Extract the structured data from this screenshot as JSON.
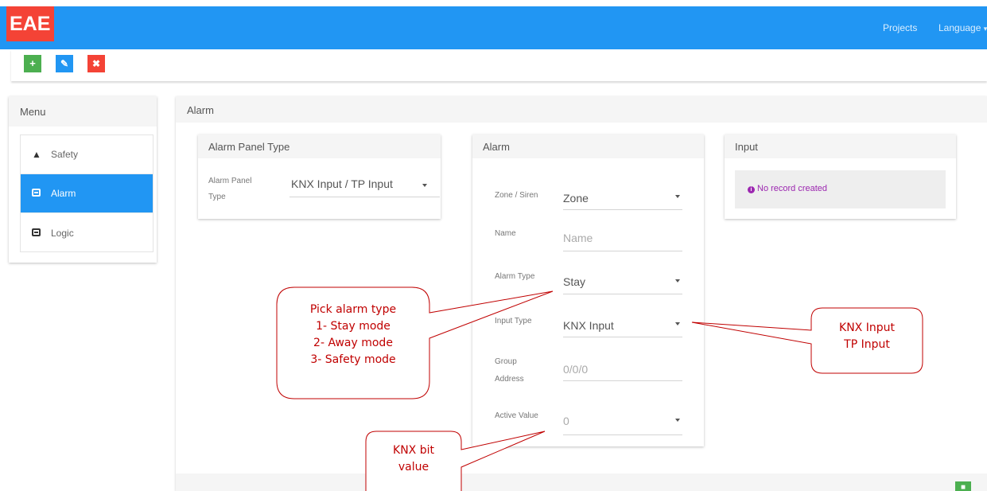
{
  "app": {
    "logo_text": "EAE",
    "nav": {
      "projects": "Projects",
      "language": "Language"
    },
    "toolbar": {
      "add_icon": "plus-icon",
      "edit_icon": "pencil-icon",
      "delete_icon": "close-icon"
    }
  },
  "menu": {
    "title": "Menu",
    "items": [
      {
        "label": "Safety",
        "icon": "warning-icon",
        "active": false
      },
      {
        "label": "Alarm",
        "icon": "panel-icon",
        "active": true
      },
      {
        "label": "Logic",
        "icon": "panel-icon",
        "active": false
      }
    ]
  },
  "main": {
    "title": "Alarm",
    "panel_type_card": {
      "title": "Alarm Panel Type",
      "field_label_line1": "Alarm Panel",
      "field_label_line2": "Type",
      "value": "KNX Input / TP Input"
    },
    "alarm_card": {
      "title": "Alarm",
      "fields": {
        "zone_label": "Zone / Siren",
        "zone_value": "Zone",
        "name_label": "Name",
        "name_placeholder": "Name",
        "alarm_type_label": "Alarm Type",
        "alarm_type_value": "Stay",
        "input_type_label": "Input Type",
        "input_type_value": "KNX Input",
        "group_label_line1": "Group",
        "group_label_line2": "Address",
        "group_placeholder": "0/0/0",
        "active_label": "Active Value",
        "active_value": "0"
      }
    },
    "input_card": {
      "title": "Input",
      "empty_text": "No record created"
    }
  },
  "annotations": {
    "alarm_type_note": "Pick alarm type\n1- Stay mode\n2- Away mode\n3- Safety mode",
    "input_type_note": "KNX Input\nTP Input",
    "active_value_note": "KNX bit\nvalue"
  },
  "colors": {
    "primary": "#2196f3",
    "add": "#4caf50",
    "delete": "#f44336",
    "annotation": "#c00000",
    "info": "#9c27b0"
  }
}
